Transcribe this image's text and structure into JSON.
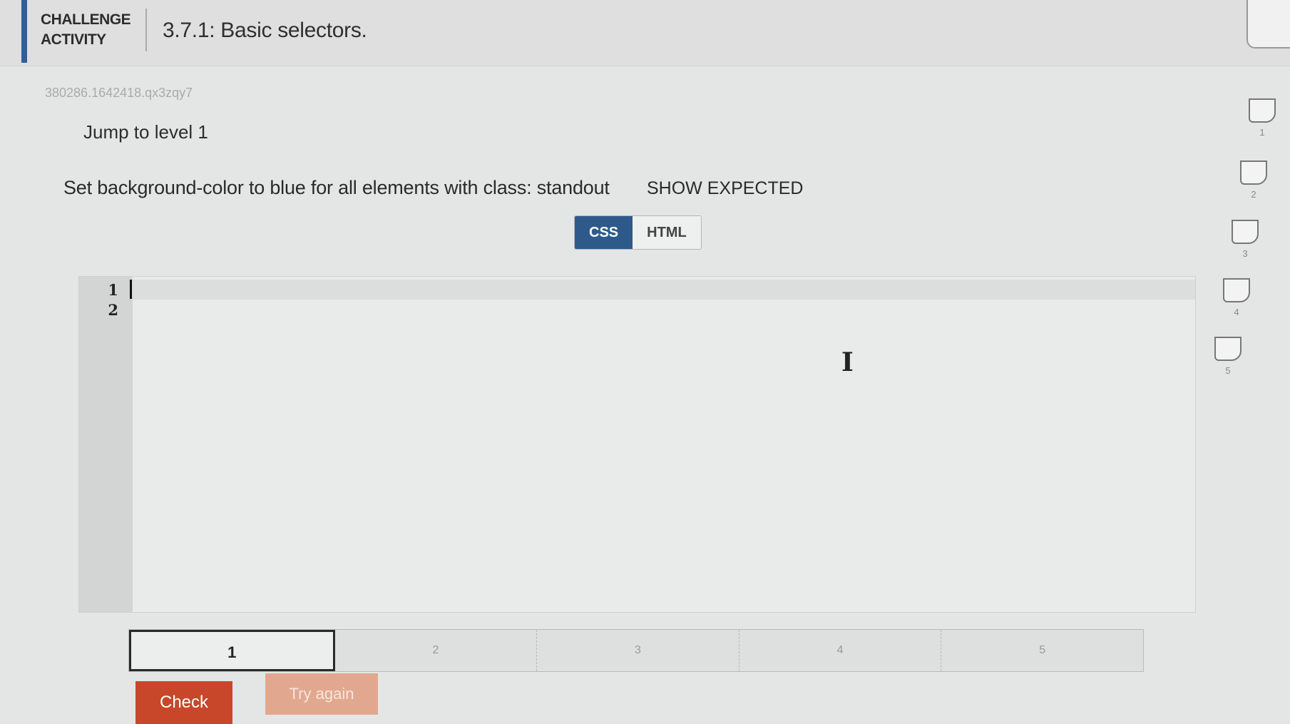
{
  "header": {
    "challenge_line1": "CHALLENGE",
    "challenge_line2": "ACTIVITY",
    "title": "3.7.1: Basic selectors."
  },
  "activity_id": "380286.1642418.qx3zqy7",
  "jump_level": "Jump to level 1",
  "instructions": "Set background-color to blue for all elements with class: standout",
  "show_expected": "SHOW EXPECTED",
  "tabs": [
    {
      "label": "CSS",
      "active": true
    },
    {
      "label": "HTML",
      "active": false
    }
  ],
  "editor": {
    "line_numbers": [
      "1",
      "2"
    ]
  },
  "levels": [
    "1",
    "2",
    "3",
    "4",
    "5"
  ],
  "current_level": "1",
  "buttons": {
    "check": "Check",
    "try_again": "Try again"
  },
  "progress": [
    "1",
    "2",
    "3",
    "4",
    "5"
  ],
  "colors": {
    "accent": "#2d5a8a",
    "check_button": "#c8472a",
    "try_again_button": "#e2a88f"
  }
}
